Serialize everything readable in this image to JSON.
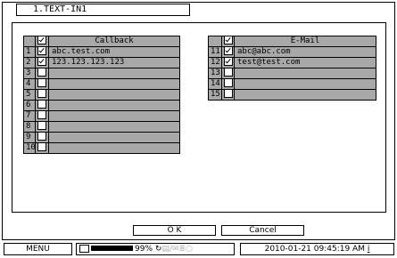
{
  "window": {
    "tab_title": "1.TEXT-IN1"
  },
  "callback_table": {
    "header": "Callback",
    "header_checked": true,
    "rows": [
      {
        "num": "1",
        "checked": true,
        "value": "abc.test.com"
      },
      {
        "num": "2",
        "checked": true,
        "value": "123.123.123.123"
      },
      {
        "num": "3",
        "checked": false,
        "value": ""
      },
      {
        "num": "4",
        "checked": false,
        "value": ""
      },
      {
        "num": "5",
        "checked": false,
        "value": ""
      },
      {
        "num": "6",
        "checked": false,
        "value": ""
      },
      {
        "num": "7",
        "checked": false,
        "value": ""
      },
      {
        "num": "8",
        "checked": false,
        "value": ""
      },
      {
        "num": "9",
        "checked": false,
        "value": ""
      },
      {
        "num": "10",
        "checked": false,
        "value": ""
      }
    ]
  },
  "email_table": {
    "header": "E-Mail",
    "header_checked": true,
    "rows": [
      {
        "num": "11",
        "checked": true,
        "value": "abc@abc.com"
      },
      {
        "num": "12",
        "checked": true,
        "value": "test@test.com"
      },
      {
        "num": "13",
        "checked": false,
        "value": ""
      },
      {
        "num": "14",
        "checked": false,
        "value": ""
      },
      {
        "num": "15",
        "checked": false,
        "value": ""
      }
    ]
  },
  "buttons": {
    "ok": "O K",
    "cancel": "Cancel"
  },
  "status_bar": {
    "menu": "MENU",
    "disk_percent": "99%",
    "disk_fill": 0.99,
    "datetime": "2010-01-21 09:45:19 AM",
    "icons": [
      "hdd-icon",
      "network-icon",
      "record-icon",
      "alarm-icon",
      "mail-icon",
      "speaker-icon"
    ]
  }
}
